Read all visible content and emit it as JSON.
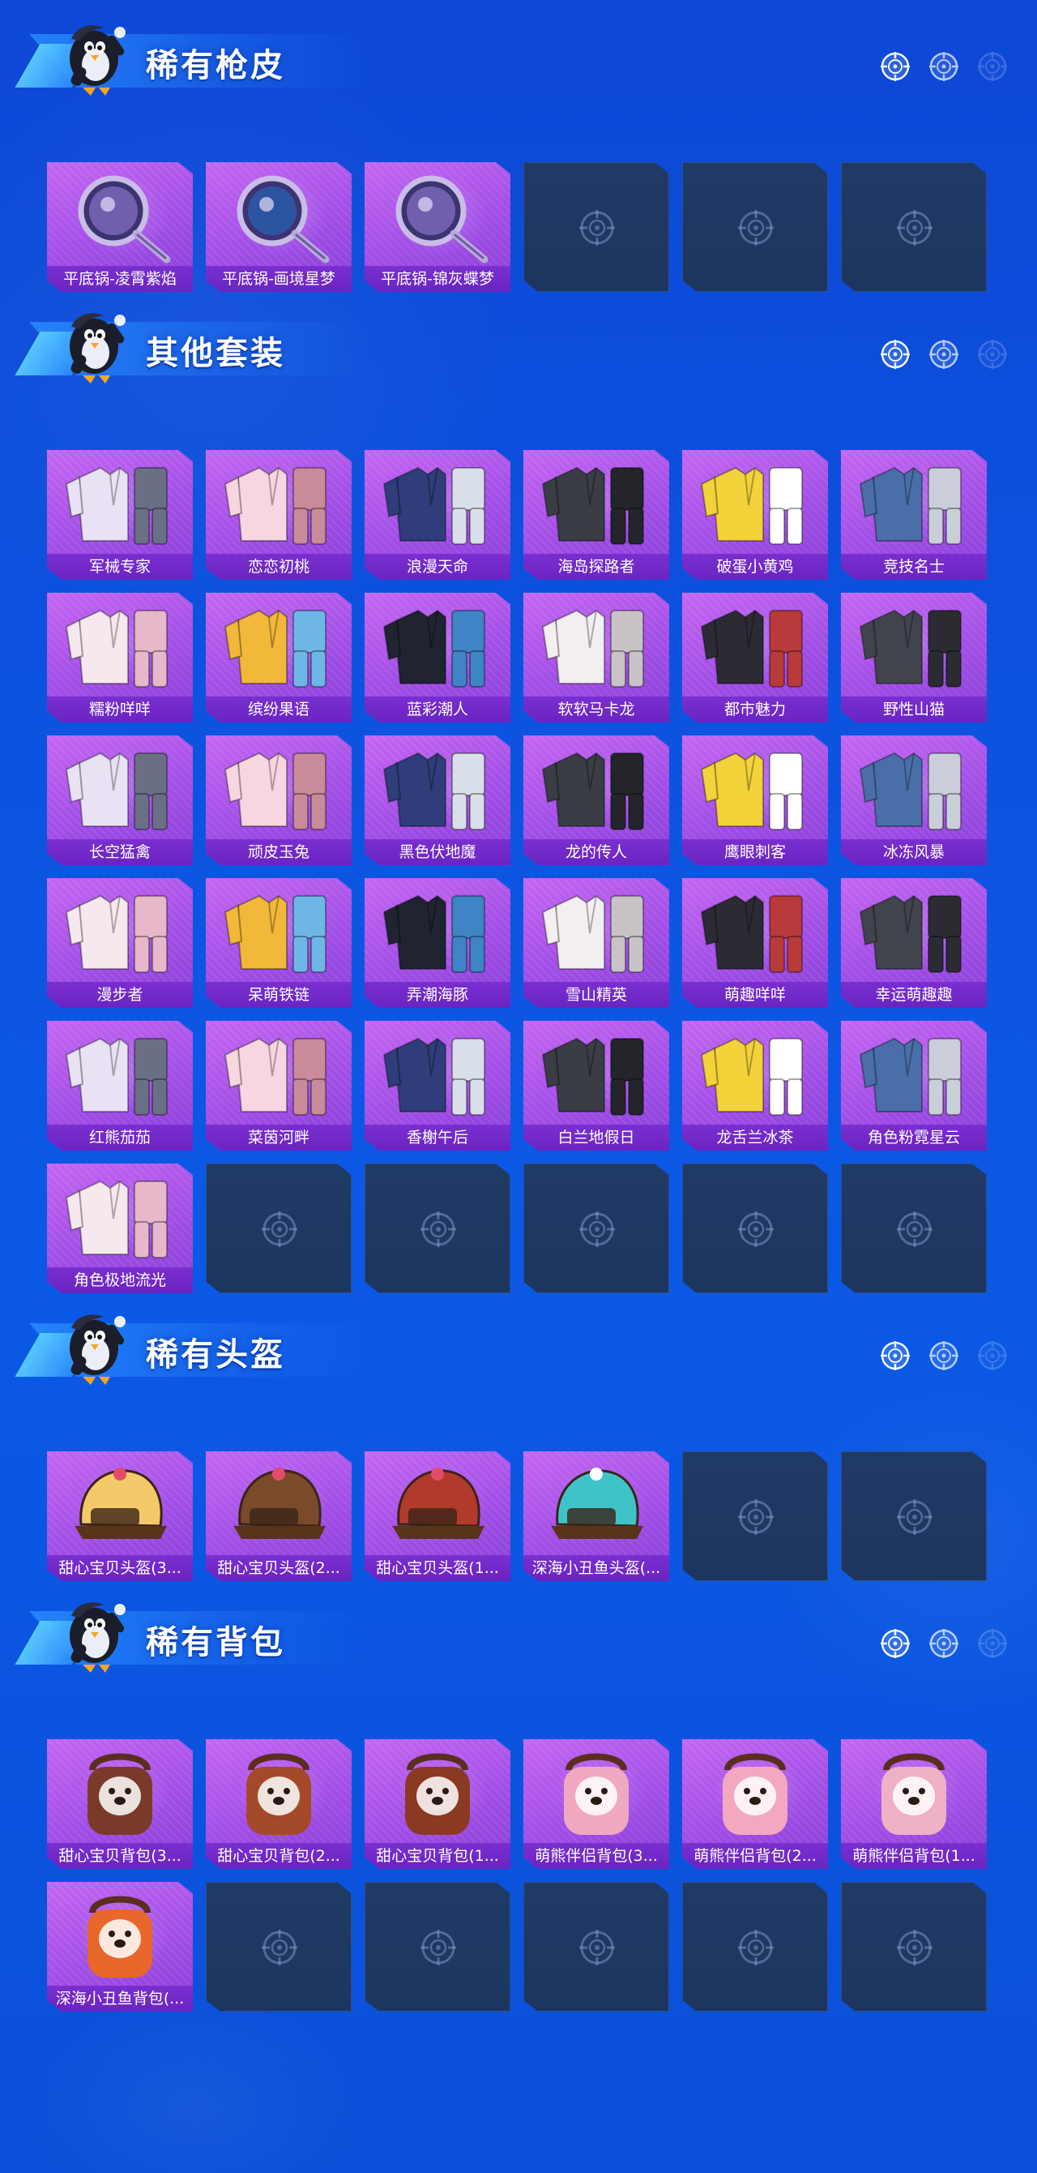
{
  "sections": [
    {
      "title": "稀有枪皮",
      "items": [
        "平底锅-凌霄紫焰",
        "平底锅-画境星梦",
        "平底锅-锦灰蝶梦"
      ],
      "empty_slots": 3
    },
    {
      "title": "其他套装",
      "items": [
        "军械专家",
        "恋恋初桃",
        "浪漫天命",
        "海岛探路者",
        "破蛋小黄鸡",
        "竞技名士",
        "糯粉咩咩",
        "缤纷果语",
        "蓝彩潮人",
        "软软马卡龙",
        "都市魅力",
        "野性山猫",
        "长空猛禽",
        "顽皮玉兔",
        "黑色伏地魔",
        "龙的传人",
        "鹰眼刺客",
        "冰冻风暴",
        "漫步者",
        "呆萌铁链",
        "弄潮海豚",
        "雪山精英",
        "萌趣咩咩",
        "幸运萌趣趣",
        "红熊茄茄",
        "菜茵河畔",
        "香榭午后",
        "白兰地假日",
        "龙舌兰冰茶",
        "角色粉霓星云",
        "角色极地流光"
      ],
      "empty_slots": 5
    },
    {
      "title": "稀有头盔",
      "items": [
        "甜心宝贝头盔(3...",
        "甜心宝贝头盔(2...",
        "甜心宝贝头盔(1...",
        "深海小丑鱼头盔(..."
      ],
      "empty_slots": 2
    },
    {
      "title": "稀有背包",
      "items": [
        "甜心宝贝背包(3...",
        "甜心宝贝背包(2...",
        "甜心宝贝背包(1...",
        "萌熊伴侣背包(3...",
        "萌熊伴侣背包(2...",
        "萌熊伴侣背包(1...",
        "深海小丑鱼背包(..."
      ],
      "empty_slots": 5
    }
  ],
  "icons": {
    "mascot": "penguin-mascot-icon",
    "reticle": "crosshair-icon"
  },
  "colors": {
    "background": "#0c54e0",
    "card": "#a14ee6",
    "card_label": "#6a24c2",
    "empty_slot": "#1d365f"
  }
}
